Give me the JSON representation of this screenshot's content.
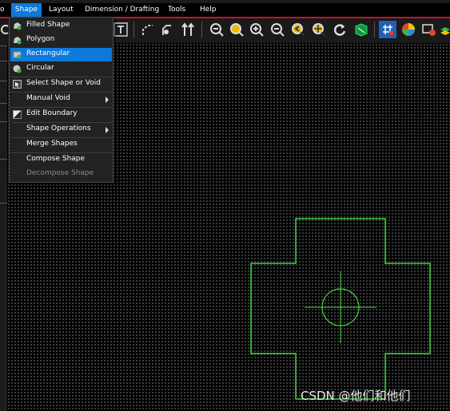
{
  "menubar": {
    "items": [
      {
        "label": "o"
      },
      {
        "label": "Shape"
      },
      {
        "label": "Layout"
      },
      {
        "label": "Dimension / Drafting"
      },
      {
        "label": "Tools"
      },
      {
        "label": "Help"
      }
    ],
    "active_index": 1
  },
  "shape_menu": {
    "items": [
      {
        "label": "Filled Shape",
        "icon": "filled-shape-icon",
        "enabled": true
      },
      {
        "label": "Polygon",
        "icon": "polygon-icon",
        "enabled": true
      },
      {
        "label": "Rectangular",
        "icon": "rectangle-shape-icon",
        "enabled": true,
        "highlighted": true
      },
      {
        "label": "Circular",
        "icon": "circle-shape-icon",
        "enabled": true
      },
      {
        "label": "Select Shape or Void",
        "icon": "select-shape-icon",
        "enabled": true
      },
      {
        "label": "Manual Void",
        "enabled": true,
        "has_submenu": true
      },
      {
        "label": "Edit Boundary",
        "icon": "edit-boundary-icon",
        "enabled": true
      },
      {
        "label": "Shape Operations",
        "enabled": true,
        "has_submenu": true
      },
      {
        "label": "Merge Shapes",
        "enabled": true
      },
      {
        "label": "Compose Shape",
        "enabled": true
      },
      {
        "label": "Decompose Shape",
        "enabled": false
      }
    ]
  },
  "toolbar": {
    "icons": [
      "text-tool-icon",
      "route-icon",
      "slide-icon",
      "spread-icon",
      "zoom-fit-icon",
      "zoom-window-icon",
      "zoom-in-icon",
      "zoom-out-icon",
      "zoom-previous-icon",
      "zoom-center-icon",
      "redraw-icon",
      "3d-view-icon",
      "grid-toggle-icon",
      "color-palette-icon",
      "layer-visibility-icon",
      "stack-layers-icon"
    ]
  },
  "colors": {
    "menu_highlight": "#0d79d8",
    "canvas_grid": "#8d8d8d",
    "shape_outline": "#3fd43f",
    "accent_red": "#c8102e"
  },
  "watermark": "CSDN @他们和他们"
}
